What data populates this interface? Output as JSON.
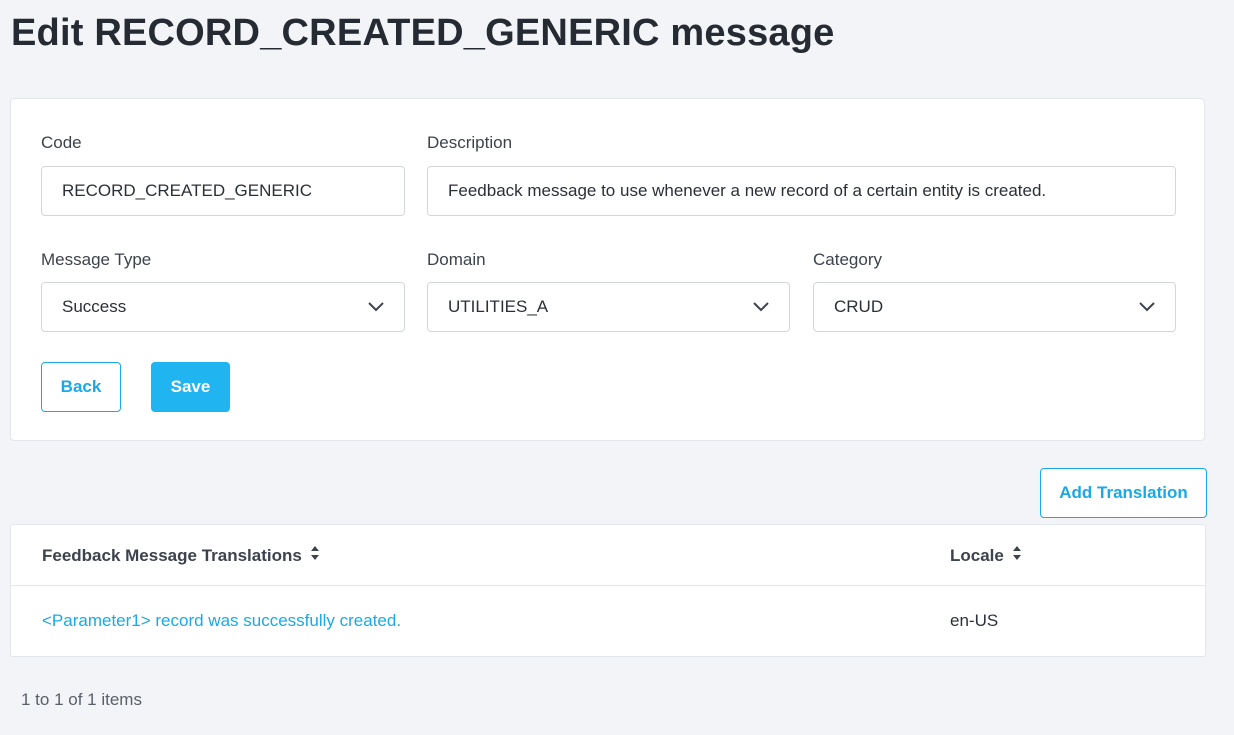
{
  "page": {
    "title": "Edit RECORD_CREATED_GENERIC message"
  },
  "form": {
    "code": {
      "label": "Code",
      "value": "RECORD_CREATED_GENERIC"
    },
    "description": {
      "label": "Description",
      "value": "Feedback message to use whenever a new record of a certain entity is created."
    },
    "message_type": {
      "label": "Message Type",
      "value": "Success"
    },
    "domain": {
      "label": "Domain",
      "value": "UTILITIES_A"
    },
    "category": {
      "label": "Category",
      "value": "CRUD"
    },
    "back_label": "Back",
    "save_label": "Save"
  },
  "translations": {
    "add_label": "Add Translation",
    "columns": {
      "message": "Feedback Message Translations",
      "locale": "Locale"
    },
    "rows": [
      {
        "message": "<Parameter1> record was successfully created.",
        "locale": "en-US"
      }
    ],
    "pager_text": "1 to 1 of 1 items"
  },
  "colors": {
    "accent": "#20b4f0",
    "background": "#f2f4f7"
  },
  "icons": {
    "select_chevron": "chevron-down-icon",
    "sort": "sort-icon"
  }
}
